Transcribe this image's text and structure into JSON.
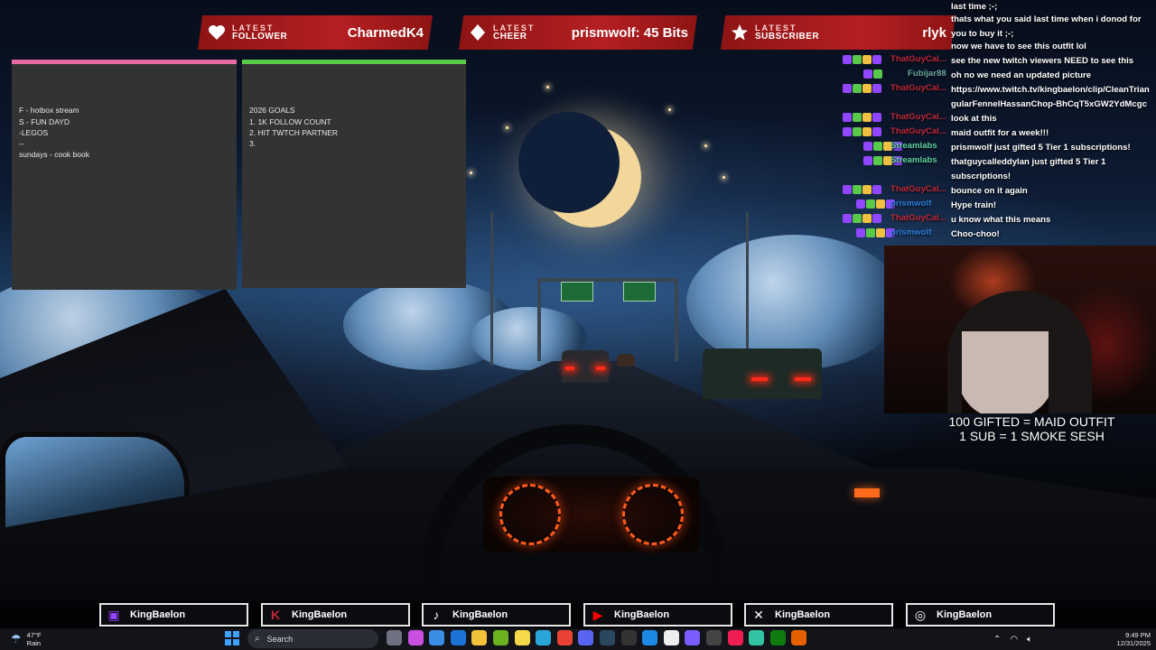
{
  "alerts": [
    {
      "small": "LATEST",
      "big": "FOLLOWER",
      "value": "CharmedK4",
      "icon": "heart-icon"
    },
    {
      "small": "LATEST",
      "big": "CHEER",
      "value": "prismwolf: 45 Bits",
      "icon": "diamond-icon"
    },
    {
      "small": "LATEST",
      "big": "SUBSCRIBER",
      "value": "rlyk",
      "icon": "star-icon"
    }
  ],
  "notes": [
    {
      "text": "F -  hotbox stream\nS - FUN DAYD\n-LEGOS\n--\nsundays - cook book",
      "bar_color": "#e86aa0"
    },
    {
      "text": "2026 GOALS\n1. 1K FOLLOW COUNT\n2. HIT TWTCH PARTNER\n3.",
      "bar_color": "#59c94a"
    }
  ],
  "chat": [
    {
      "user": "",
      "user_color": "#ffffff",
      "message": "last time ;-;"
    },
    {
      "user": "",
      "user_color": "#ffffff",
      "message": "thats what you said last time when i donod for you to buy it ;-;"
    },
    {
      "user": "",
      "user_color": "#ffffff",
      "message": "now we have to see this outfit lol"
    },
    {
      "user": "ThatGuyCal...",
      "user_color": "#c0283a",
      "message": "see the new twitch viewers NEED to see this"
    },
    {
      "user": "Fubijar88",
      "user_color": "#6aa8a0",
      "message": "oh no we need an updated picture"
    },
    {
      "user": "ThatGuyCal...",
      "user_color": "#c0283a",
      "message": "https://www.twitch.tv/kingbaelon/clip/CleanTriangularFennelHassanChop-BhCqT5xGW2YdMcgc"
    },
    {
      "user": "ThatGuyCal...",
      "user_color": "#c0283a",
      "message": "look at this"
    },
    {
      "user": "ThatGuyCal...",
      "user_color": "#c0283a",
      "message": "maid outfit for a week!!!"
    },
    {
      "user": "Streamlabs",
      "user_color": "#5fd3a0",
      "message": "prismwolf just gifted 5 Tier 1 subscriptions!"
    },
    {
      "user": "Streamlabs",
      "user_color": "#5fd3a0",
      "message": "thatguycalleddylan just gifted 5 Tier 1 subscriptions!"
    },
    {
      "user": "ThatGuyCal...",
      "user_color": "#c0283a",
      "message": "bounce on it again"
    },
    {
      "user": "prismwolf",
      "user_color": "#2e7fe0",
      "message": "Hype train!"
    },
    {
      "user": "ThatGuyCal...",
      "user_color": "#c0283a",
      "message": "u know what this means"
    },
    {
      "user": "prismwolf",
      "user_color": "#2e7fe0",
      "message": "Choo-choo!"
    }
  ],
  "goal_text": {
    "line1": "100 GIFTED = MAID OUTFIT",
    "line2": "1 SUB = 1 SMOKE SESH"
  },
  "socials": [
    {
      "icon": "twitch-icon",
      "glyph": "▣",
      "color": "#9146ff",
      "name": "KingBaelon"
    },
    {
      "icon": "kick-icon",
      "glyph": "K",
      "color": "#c0283a",
      "name": "KingBaelon"
    },
    {
      "icon": "tiktok-icon",
      "glyph": "♪",
      "color": "#ffffff",
      "name": "KingBaelon"
    },
    {
      "icon": "youtube-icon",
      "glyph": "▶",
      "color": "#ff0000",
      "name": "KingBaelon"
    },
    {
      "icon": "x-icon",
      "glyph": "✕",
      "color": "#ffffff",
      "name": "KingBaelon"
    },
    {
      "icon": "instagram-icon",
      "glyph": "◎",
      "color": "#ffffff",
      "name": "KingBaelon"
    }
  ],
  "taskbar": {
    "weather_temp": "47°F",
    "weather_desc": "Rain",
    "search_placeholder": "Search",
    "time": "9:49 PM",
    "date": "12/31/2025",
    "apps": [
      {
        "name": "task-view-icon",
        "color": "#6e7280"
      },
      {
        "name": "copilot-icon",
        "color": "#c84fe0"
      },
      {
        "name": "store-icon",
        "color": "#3b8ee6"
      },
      {
        "name": "outlook-icon",
        "color": "#1d72d6"
      },
      {
        "name": "explorer-icon",
        "color": "#f2c23a"
      },
      {
        "name": "nvidia-icon",
        "color": "#6bb120"
      },
      {
        "name": "sticky-notes-icon",
        "color": "#f6d84b"
      },
      {
        "name": "edge-icon",
        "color": "#2aa7d8"
      },
      {
        "name": "chrome-icon",
        "color": "#e94235"
      },
      {
        "name": "discord-icon",
        "color": "#5865f2"
      },
      {
        "name": "steam-icon",
        "color": "#2a475e"
      },
      {
        "name": "epic-icon",
        "color": "#333333"
      },
      {
        "name": "messenger-icon",
        "color": "#1e88e5"
      },
      {
        "name": "capcut-icon",
        "color": "#eeeeee"
      },
      {
        "name": "grid-app-icon",
        "color": "#7b5cff"
      },
      {
        "name": "obs-icon",
        "color": "#444444"
      },
      {
        "name": "tiktok-app-icon",
        "color": "#ee1d52"
      },
      {
        "name": "streamlabs-icon",
        "color": "#31c3a2"
      },
      {
        "name": "xbox-icon",
        "color": "#107c10"
      },
      {
        "name": "firefox-icon",
        "color": "#e66000"
      }
    ]
  }
}
